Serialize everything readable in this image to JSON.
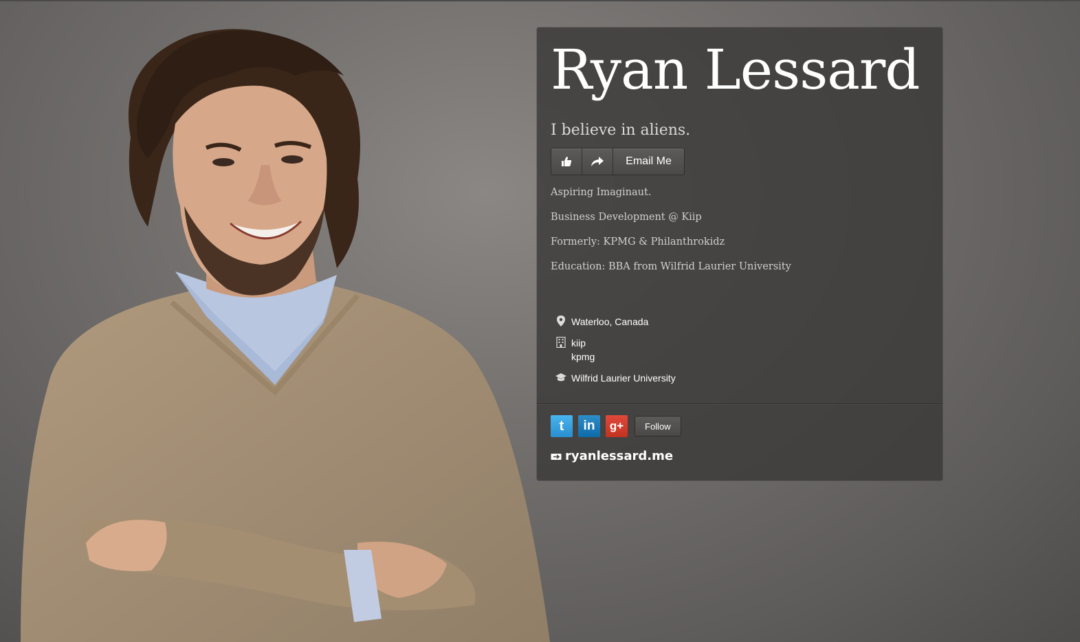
{
  "profile": {
    "name": "Ryan Lessard",
    "headline": "I believe in aliens.",
    "bio": [
      "Aspiring Imaginaut.",
      "Business Development @ Kiip",
      "Formerly: KPMG & Philanthrokidz",
      "Education: BBA from Wilfrid Laurier University"
    ]
  },
  "actions": {
    "like_icon": "thumbs-up-icon",
    "share_icon": "share-arrow-icon",
    "email_label": "Email Me"
  },
  "facts": {
    "location": "Waterloo, Canada",
    "work": [
      "kiip",
      "kpmg"
    ],
    "education": "Wilfrid Laurier University",
    "icons": [
      "location-pin-icon",
      "building-icon",
      "graduation-cap-icon"
    ]
  },
  "social": {
    "networks": [
      {
        "name": "twitter",
        "glyph": "t",
        "color": "#2a9ae0"
      },
      {
        "name": "linkedin",
        "glyph": "in",
        "color": "#0e6ba8"
      },
      {
        "name": "google-plus",
        "glyph": "g+",
        "color": "#d0392b"
      }
    ],
    "follow_label": "Follow"
  },
  "website": {
    "label": "ryanlessard.me",
    "icon": "link-icon"
  }
}
